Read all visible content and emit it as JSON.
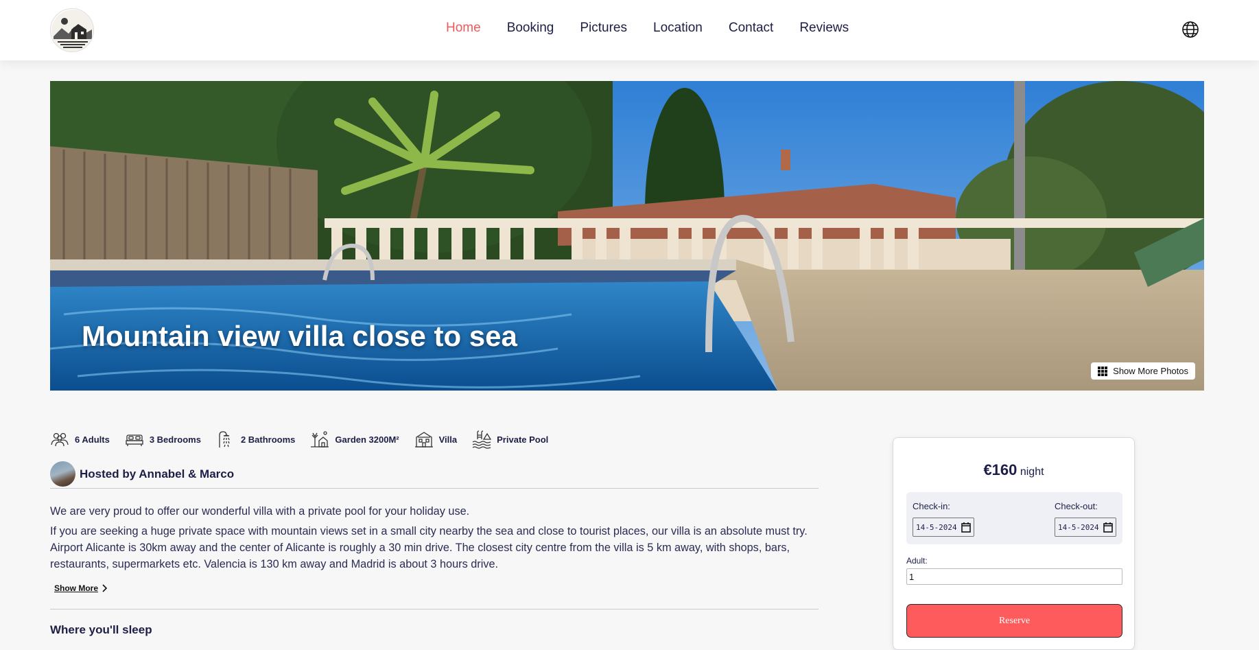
{
  "nav": {
    "items": [
      "Home",
      "Booking",
      "Pictures",
      "Location",
      "Contact",
      "Reviews"
    ],
    "active": "Home"
  },
  "hero": {
    "title": "Mountain view villa close to sea",
    "show_more_photos": "Show More Photos"
  },
  "features": [
    {
      "label": "6 Adults",
      "icon": "people-icon"
    },
    {
      "label": "3 Bedrooms",
      "icon": "bed-icon"
    },
    {
      "label": "2 Bathrooms",
      "icon": "shower-icon"
    },
    {
      "label": "Garden 3200M²",
      "icon": "garden-icon"
    },
    {
      "label": "Villa",
      "icon": "villa-icon"
    },
    {
      "label": "Private Pool",
      "icon": "pool-icon"
    }
  ],
  "host": {
    "label": "Hosted by Annabel & Marco"
  },
  "description": {
    "p1": "We are very proud to offer our wonderful villa with a private pool for your holiday use.",
    "p2": "If you are seeking a huge private space with mountain views set in a small city nearby the sea and close to tourist places, our villa is an absolute must try. Airport Alicante is 30km away and the center of Alicante is roughly a 30 min drive. The closest city centre from the villa is 5 km away, with shops, bars, restaurants, supermarkets etc. Valencia is 130 km away and Madrid is about 3 hours drive.",
    "show_more": "Show More"
  },
  "sleep_heading": "Where you'll sleep",
  "booking": {
    "price": "€160",
    "unit": "night",
    "checkin_label": "Check-in:",
    "checkin_value": "14-5-2024",
    "checkout_label": "Check-out:",
    "checkout_value": "14-5-2024",
    "adult_label": "Adult:",
    "adult_value": "1",
    "reserve_label": "Reserve"
  },
  "colors": {
    "accent": "#f05a5a",
    "reserve": "#fe5b5c",
    "text": "#1c1e46"
  }
}
